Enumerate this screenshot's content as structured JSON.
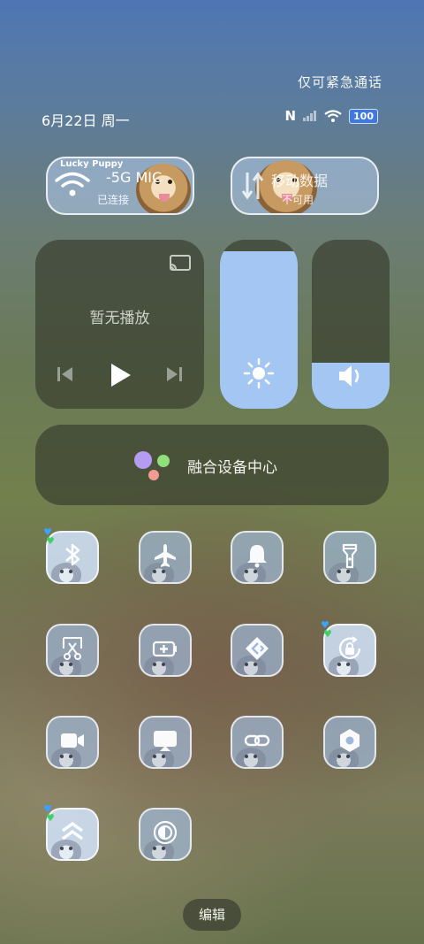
{
  "status_bar": {
    "emergency_text": "仅可紧急通话",
    "date_text": "6月22日 周一",
    "nfc_label": "N",
    "battery_level": "100"
  },
  "connectivity": {
    "wifi": {
      "title": "-5G    MIC",
      "subtitle": "已连接",
      "theme_tag": "Lucky Puppy",
      "active": true
    },
    "mobile_data": {
      "title": "移动数据",
      "subtitle": "不可用",
      "active": false
    }
  },
  "media": {
    "status_text": "暂无播放"
  },
  "sliders": {
    "brightness_level": 0.93,
    "volume_level": 0.27
  },
  "fusion_center": {
    "label": "融合设备中心",
    "dot_colors": [
      "#b39cf2",
      "#8fe07a",
      "#f29a94"
    ]
  },
  "tiles": [
    {
      "name": "bluetooth-toggle",
      "icon": "bluetooth-icon",
      "active": true,
      "badge": true
    },
    {
      "name": "airplane-mode-toggle",
      "icon": "airplane-icon",
      "active": false,
      "badge": false
    },
    {
      "name": "silent-mode-toggle",
      "icon": "bell-icon",
      "active": false,
      "badge": false
    },
    {
      "name": "flashlight-toggle",
      "icon": "flashlight-icon",
      "active": false,
      "badge": false
    },
    {
      "name": "screenshot-toggle",
      "icon": "screenshot-scissors-icon",
      "active": false,
      "badge": false
    },
    {
      "name": "power-saving-toggle",
      "icon": "battery-plus-icon",
      "active": false,
      "badge": false
    },
    {
      "name": "nearby-share-toggle",
      "icon": "share-diamond-icon",
      "active": false,
      "badge": false
    },
    {
      "name": "rotation-lock-toggle",
      "icon": "rotation-lock-icon",
      "active": true,
      "badge": true
    },
    {
      "name": "screen-record-toggle",
      "icon": "video-camera-icon",
      "active": false,
      "badge": false
    },
    {
      "name": "screen-cast-toggle",
      "icon": "screen-cast-icon",
      "active": false,
      "badge": false
    },
    {
      "name": "multi-device-link-toggle",
      "icon": "link-icon",
      "active": false,
      "badge": false
    },
    {
      "name": "settings-toggle",
      "icon": "hexagon-gear-icon",
      "active": false,
      "badge": false
    },
    {
      "name": "performance-mode-toggle",
      "icon": "chevrons-up-icon",
      "active": true,
      "badge": true
    },
    {
      "name": "dark-mode-toggle",
      "icon": "contrast-icon",
      "active": false,
      "badge": false
    }
  ],
  "edit_button": {
    "label": "编辑"
  },
  "colors": {
    "accent_blue": "#a3c6f2",
    "panel_dark": "#3a4030",
    "badge_blue": "#3e78e0"
  }
}
